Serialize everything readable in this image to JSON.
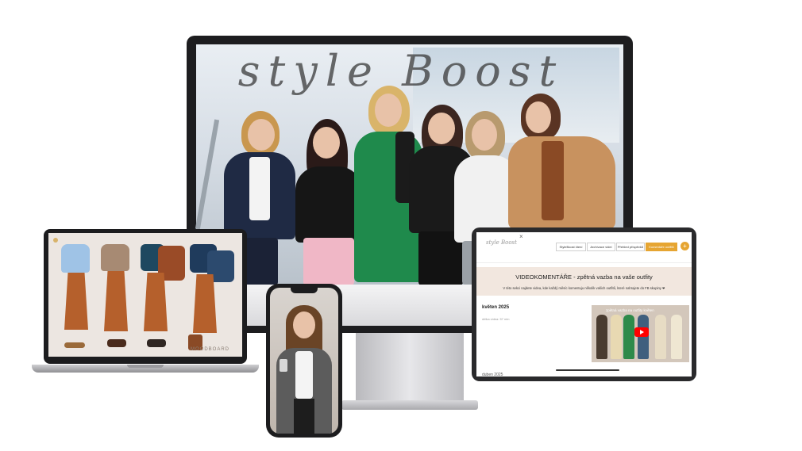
{
  "desktop": {
    "hero_title": "style Boost"
  },
  "laptop": {
    "board_label": "MOODBOARD"
  },
  "tablet": {
    "logo": "style Boost",
    "close_icon": "×",
    "nav": [
      {
        "label": "StyleBoost čtení"
      },
      {
        "label": "Archívace videí"
      },
      {
        "label": "Přehled příspěvků"
      },
      {
        "label": "Komentáře outfitů",
        "active": true
      }
    ],
    "plus": "+",
    "heading": "VIDEOKOMENTÁŘE - zpětná vazba na vaše outfity",
    "subheading": "V této sekci najdete videa, kde každý měsíc komentuju několik vašich outfitů, které nahrajete do FB skupiny ❤",
    "month": "květen 2025",
    "video_length": "délka videa: 57 min",
    "video_title": "zpětná vazba na outfity květen",
    "month2": "duben 2025"
  },
  "colors": {
    "accent": "#e6a532",
    "banner": "#f2e7df",
    "play": "#ff0000"
  }
}
